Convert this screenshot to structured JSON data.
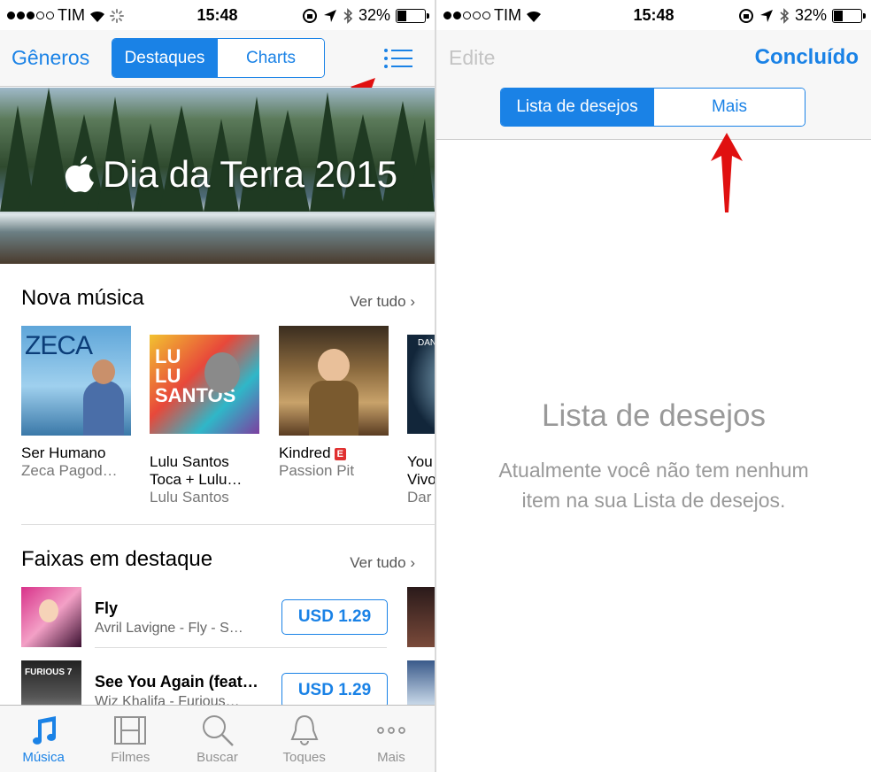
{
  "status_left": {
    "carrier": "TIM",
    "time": "15:48",
    "battery": "32%"
  },
  "status_right": {
    "carrier": "TIM",
    "time": "15:48",
    "battery": "32%"
  },
  "left": {
    "nav": {
      "generos": "Gêneros",
      "seg_active": "Destaques",
      "seg_other": "Charts"
    },
    "banner": {
      "title": "Dia da Terra 2015"
    },
    "nova_musica": {
      "title": "Nova música",
      "ver_tudo": "Ver tudo",
      "albums": [
        {
          "title": "Ser Humano",
          "title2": "",
          "artist": "Zeca Pagod…",
          "cover_text": "ZECA"
        },
        {
          "title": "Lulu Santos",
          "title2": "Toca + Lulu…",
          "artist": "Lulu Santos",
          "cover_text": "LULU SANTOS"
        },
        {
          "title": "Kindred",
          "badge": "E",
          "title2": "",
          "artist": "Passion Pit",
          "cover_text": ""
        },
        {
          "title": "You",
          "title2": "Vivo",
          "artist": "Dar",
          "cover_text": "DAN"
        }
      ]
    },
    "faixas": {
      "title": "Faixas em destaque",
      "ver_tudo": "Ver tudo",
      "tracks": [
        {
          "title": "Fly",
          "subtitle": "Avril Lavigne - Fly - S…",
          "price": "USD 1.29"
        },
        {
          "title": "See You Again (feat…",
          "subtitle": "Wiz Khalifa - Furious…",
          "price": "USD 1.29",
          "art_text": "FURIOUS 7"
        }
      ]
    },
    "tabs": [
      {
        "label": "Música",
        "icon": "music-note-icon"
      },
      {
        "label": "Filmes",
        "icon": "film-icon"
      },
      {
        "label": "Buscar",
        "icon": "search-icon"
      },
      {
        "label": "Toques",
        "icon": "bell-icon"
      },
      {
        "label": "Mais",
        "icon": "more-icon"
      }
    ]
  },
  "right": {
    "nav": {
      "edit": "Edite",
      "done": "Concluído",
      "seg_active": "Lista de desejos",
      "seg_other": "Mais"
    },
    "empty": {
      "title": "Lista de desejos",
      "line1": "Atualmente você não tem nenhum",
      "line2": "item na sua Lista de desejos."
    }
  },
  "colors": {
    "accent": "#1a82e6",
    "annotation": "#e01010"
  }
}
